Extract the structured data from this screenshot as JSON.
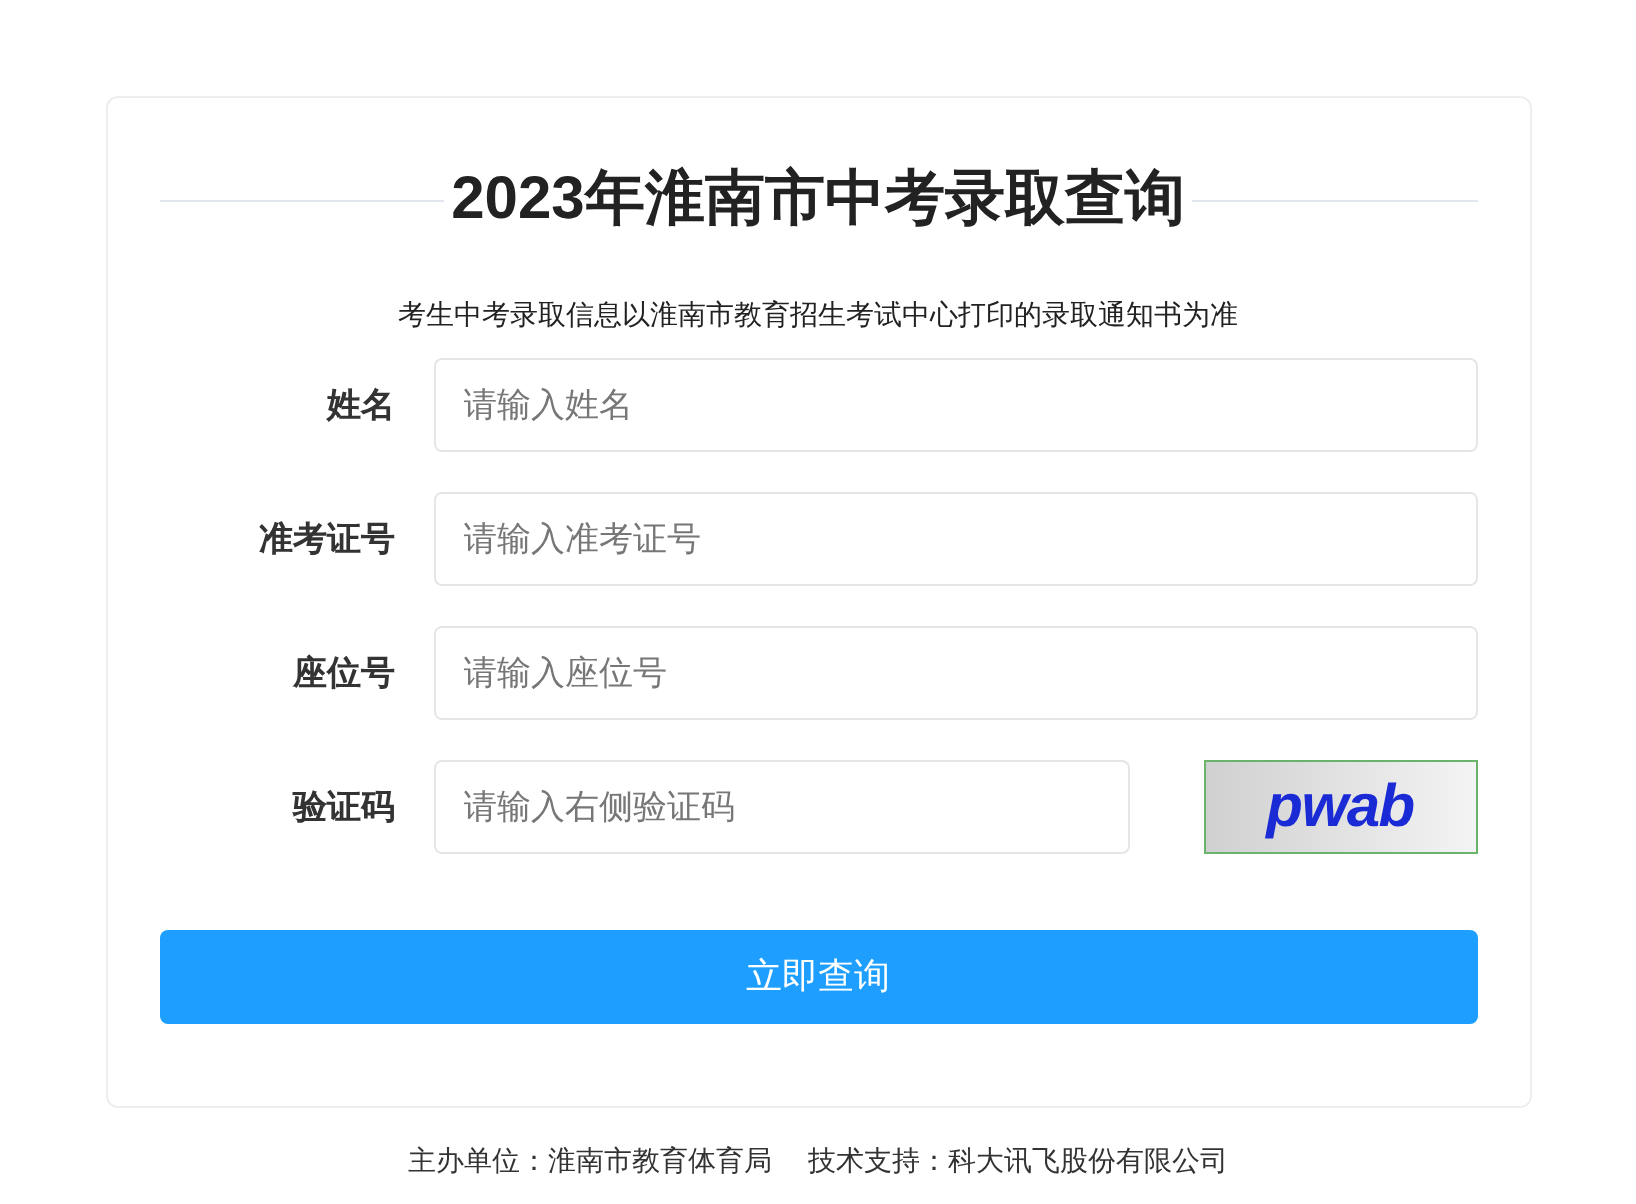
{
  "title": "2023年淮南市中考录取查询",
  "notice": "考生中考录取信息以淮南市教育招生考试中心打印的录取通知书为准",
  "fields": [
    {
      "kind": "text",
      "label": "姓名",
      "placeholder": "请输入姓名"
    },
    {
      "kind": "text",
      "label": "准考证号",
      "placeholder": "请输入准考证号"
    },
    {
      "kind": "text",
      "label": "座位号",
      "placeholder": "请输入座位号"
    },
    {
      "kind": "captcha",
      "label": "验证码",
      "placeholder": "请输入右侧验证码",
      "captcha": "pwab"
    }
  ],
  "submit": "立即查询",
  "footer": {
    "organizer": "主办单位：淮南市教育体育局",
    "support": "技术支持：科大讯飞股份有限公司"
  }
}
